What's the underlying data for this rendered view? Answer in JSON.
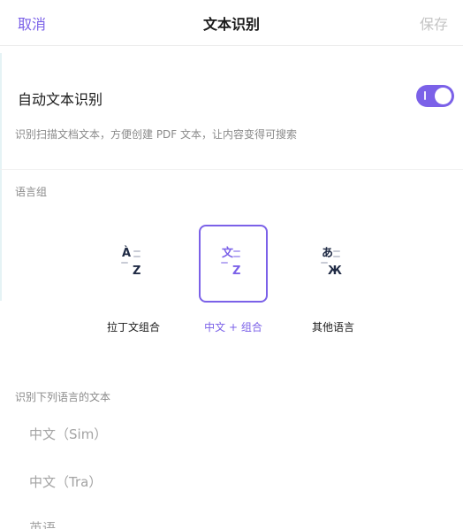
{
  "header": {
    "cancel_label": "取消",
    "title": "文本识别",
    "save_label": "保存"
  },
  "auto_ocr": {
    "label": "自动文本识别",
    "enabled": true,
    "description": "识别扫描文档文本，方便创建 PDF 文本，让内容变得可搜索"
  },
  "language_group": {
    "label": "语言组",
    "selected": "中文 + 组合",
    "options": [
      {
        "name": "拉丁文组合",
        "glyph_top": "À",
        "glyph_bottom": "Z",
        "selected": false
      },
      {
        "name": "中文 + 组合",
        "glyph_top": "文",
        "glyph_bottom": "Z",
        "selected": true
      },
      {
        "name": "其他语言",
        "glyph_top": "あ",
        "glyph_bottom": "Ж",
        "selected": false
      }
    ]
  },
  "recognize": {
    "label": "识别下列语言的文本",
    "languages": [
      "中文（Sim）",
      "中文（Tra）",
      "英语"
    ]
  },
  "colors": {
    "accent": "#7b61e8",
    "disabled_text": "#c4c4c4",
    "secondary_text": "#8a8a8a"
  }
}
